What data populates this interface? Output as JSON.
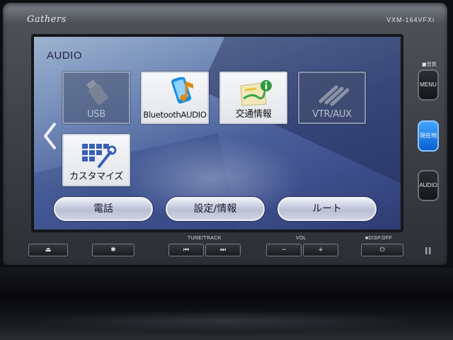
{
  "device": {
    "brand": "Gathers",
    "model": "VXM-164VFXi"
  },
  "screen": {
    "title": "AUDIO",
    "tiles": [
      {
        "label": "USB",
        "icon": "usb-stick-icon",
        "enabled": false
      },
      {
        "label": "BluetoothAUDIO",
        "icon": "bluetooth-phone-music-icon",
        "enabled": true
      },
      {
        "label": "交通情報",
        "icon": "traffic-map-info-icon",
        "enabled": true
      },
      {
        "label": "VTR/AUX",
        "icon": "av-cable-icon",
        "enabled": false
      },
      {
        "label": "カスタマイズ",
        "icon": "grid-wrench-icon",
        "enabled": true
      }
    ],
    "bottom_buttons": [
      {
        "label": "電話"
      },
      {
        "label": "設定/情報"
      },
      {
        "label": "ルート"
      }
    ],
    "back_icon": "chevron-left-icon"
  },
  "side_buttons": {
    "caption": "■音質",
    "menu": "MENU",
    "current_location": "現在地",
    "audio": "AUDIO"
  },
  "hardware_bar": {
    "tune_caption": "TUNE/TRACK",
    "vol_caption": "VOL",
    "disp_caption": "■DISP.OFF",
    "eject_symbol": "⏏",
    "settings_symbol": "✱",
    "prev_symbol": "⏮",
    "next_symbol": "⏭",
    "vol_down_symbol": "−",
    "vol_up_symbol": "+",
    "power_symbol": "⏻"
  },
  "colors": {
    "blue_button": "#1a7ee6",
    "screen_bg": "#4a5f9a"
  }
}
